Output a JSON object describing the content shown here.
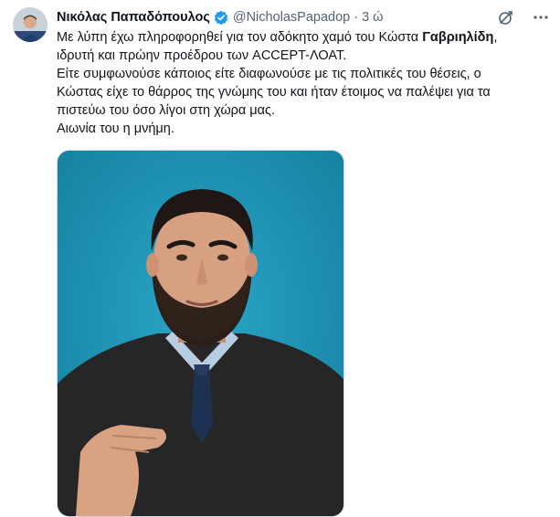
{
  "tweet": {
    "author_name": "Νικόλας Παπαδόπουλος",
    "handle": "@NicholasPapadop",
    "separator": "·",
    "time": "3 ώ",
    "lines": [
      {
        "before": "Με λύπη έχω πληροφορηθεί για τον αδόκητο χαμό του Κώστα ",
        "bold": "Γαβριηλίδη",
        "after": ","
      },
      {
        "text": "ιδρυτή και πρώην προέδρου των ACCEPT-ΛΟΑΤ."
      },
      {
        "text": "Είτε συμφωνούσε κάποιος είτε διαφωνούσε με τις πολιτικές του θέσεις, ο"
      },
      {
        "text": "Κώστας είχε το θάρρος της γνώμης του και ήταν έτοιμος να παλέψει για τα"
      },
      {
        "text": "πιστεύω του όσο λίγοι στη χώρα μας."
      },
      {
        "text": "Αιωνία του η μνήμη."
      }
    ]
  },
  "icons": {
    "verified": "verified-badge-icon",
    "grok": "grok-icon",
    "more": "more-options-icon"
  },
  "colors": {
    "accent": "#1d9bf0",
    "photo_background": "#1f93b8"
  }
}
